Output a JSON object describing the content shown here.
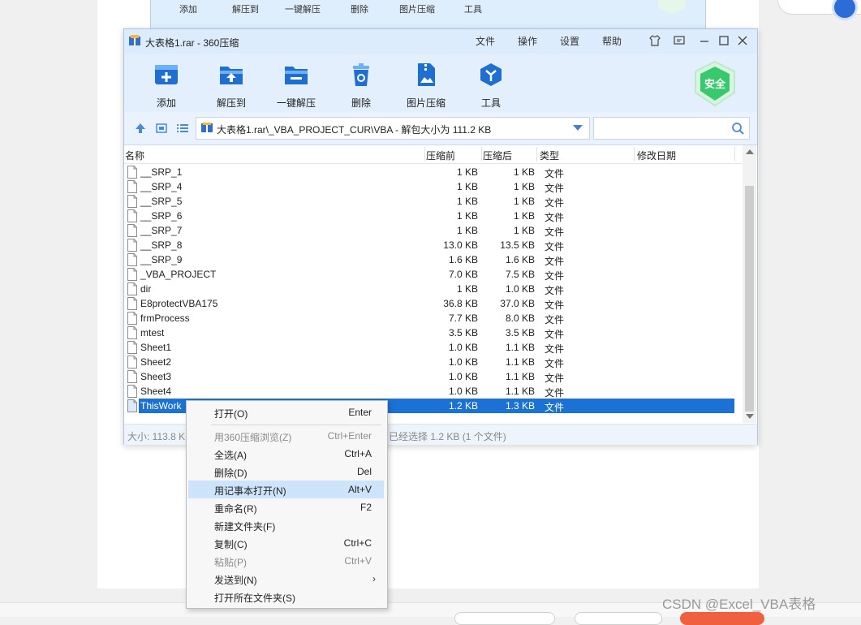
{
  "bg_window": {
    "toolbar": [
      "添加",
      "解压到",
      "一键解压",
      "删除",
      "图片压缩",
      "工具"
    ]
  },
  "window": {
    "title": "大表格1.rar - 360压缩",
    "menu": [
      "文件",
      "操作",
      "设置",
      "帮助"
    ]
  },
  "toolbar": [
    {
      "label": "添加",
      "icon": "add-icon"
    },
    {
      "label": "解压到",
      "icon": "extract-to-icon"
    },
    {
      "label": "一键解压",
      "icon": "one-click-extract-icon"
    },
    {
      "label": "删除",
      "icon": "delete-icon"
    },
    {
      "label": "图片压缩",
      "icon": "image-compress-icon"
    },
    {
      "label": "工具",
      "icon": "tools-icon"
    }
  ],
  "safe_badge": "安全",
  "address": {
    "path": "大表格1.rar\\_VBA_PROJECT_CUR\\VBA - 解包大小为 111.2 KB",
    "search_placeholder": ""
  },
  "columns": {
    "name": "名称",
    "before": "压缩前",
    "after": "压缩后",
    "type": "类型",
    "modified": "修改日期"
  },
  "files": [
    {
      "name": "__SRP_1",
      "before": "1 KB",
      "after": "1 KB",
      "type": "文件"
    },
    {
      "name": "__SRP_4",
      "before": "1 KB",
      "after": "1 KB",
      "type": "文件"
    },
    {
      "name": "__SRP_5",
      "before": "1 KB",
      "after": "1 KB",
      "type": "文件"
    },
    {
      "name": "__SRP_6",
      "before": "1 KB",
      "after": "1 KB",
      "type": "文件"
    },
    {
      "name": "__SRP_7",
      "before": "1 KB",
      "after": "1 KB",
      "type": "文件"
    },
    {
      "name": "__SRP_8",
      "before": "13.0 KB",
      "after": "13.5 KB",
      "type": "文件"
    },
    {
      "name": "__SRP_9",
      "before": "1.6 KB",
      "after": "1.6 KB",
      "type": "文件"
    },
    {
      "name": "_VBA_PROJECT",
      "before": "7.0 KB",
      "after": "7.5 KB",
      "type": "文件"
    },
    {
      "name": "dir",
      "before": "1 KB",
      "after": "1.0 KB",
      "type": "文件"
    },
    {
      "name": "E8protectVBA175",
      "before": "36.8 KB",
      "after": "37.0 KB",
      "type": "文件"
    },
    {
      "name": "frmProcess",
      "before": "7.7 KB",
      "after": "8.0 KB",
      "type": "文件"
    },
    {
      "name": "mtest",
      "before": "3.5 KB",
      "after": "3.5 KB",
      "type": "文件"
    },
    {
      "name": "Sheet1",
      "before": "1.0 KB",
      "after": "1.1 KB",
      "type": "文件"
    },
    {
      "name": "Sheet2",
      "before": "1.0 KB",
      "after": "1.1 KB",
      "type": "文件"
    },
    {
      "name": "Sheet3",
      "before": "1.0 KB",
      "after": "1.1 KB",
      "type": "文件"
    },
    {
      "name": "Sheet4",
      "before": "1.0 KB",
      "after": "1.1 KB",
      "type": "文件"
    },
    {
      "name": "ThisWork",
      "before": "1.2 KB",
      "after": "1.3 KB",
      "type": "文件",
      "selected": true
    }
  ],
  "status": {
    "left": "大小: 113.8 K",
    "right": "已经选择 1.2 KB (1 个文件)"
  },
  "context_menu": [
    {
      "label": "打开(O)",
      "shortcut": "Enter",
      "disabled": false
    },
    {
      "label": "用360压缩浏览(Z)",
      "shortcut": "Ctrl+Enter",
      "disabled": true
    },
    {
      "label": "全选(A)",
      "shortcut": "Ctrl+A",
      "disabled": false
    },
    {
      "label": "删除(D)",
      "shortcut": "Del",
      "disabled": false
    },
    {
      "label": "用记事本打开(N)",
      "shortcut": "Alt+V",
      "disabled": false,
      "highlighted": true
    },
    {
      "label": "重命名(R)",
      "shortcut": "F2",
      "disabled": false
    },
    {
      "label": "新建文件夹(F)",
      "shortcut": "",
      "disabled": false
    },
    {
      "label": "复制(C)",
      "shortcut": "Ctrl+C",
      "disabled": false
    },
    {
      "label": "粘贴(P)",
      "shortcut": "Ctrl+V",
      "disabled": true
    },
    {
      "label": "发送到(N)",
      "shortcut": "",
      "disabled": false,
      "submenu": "›"
    },
    {
      "label": "打开所在文件夹(S)",
      "shortcut": "",
      "disabled": false
    }
  ],
  "watermark": "CSDN @Excel_VBA表格"
}
